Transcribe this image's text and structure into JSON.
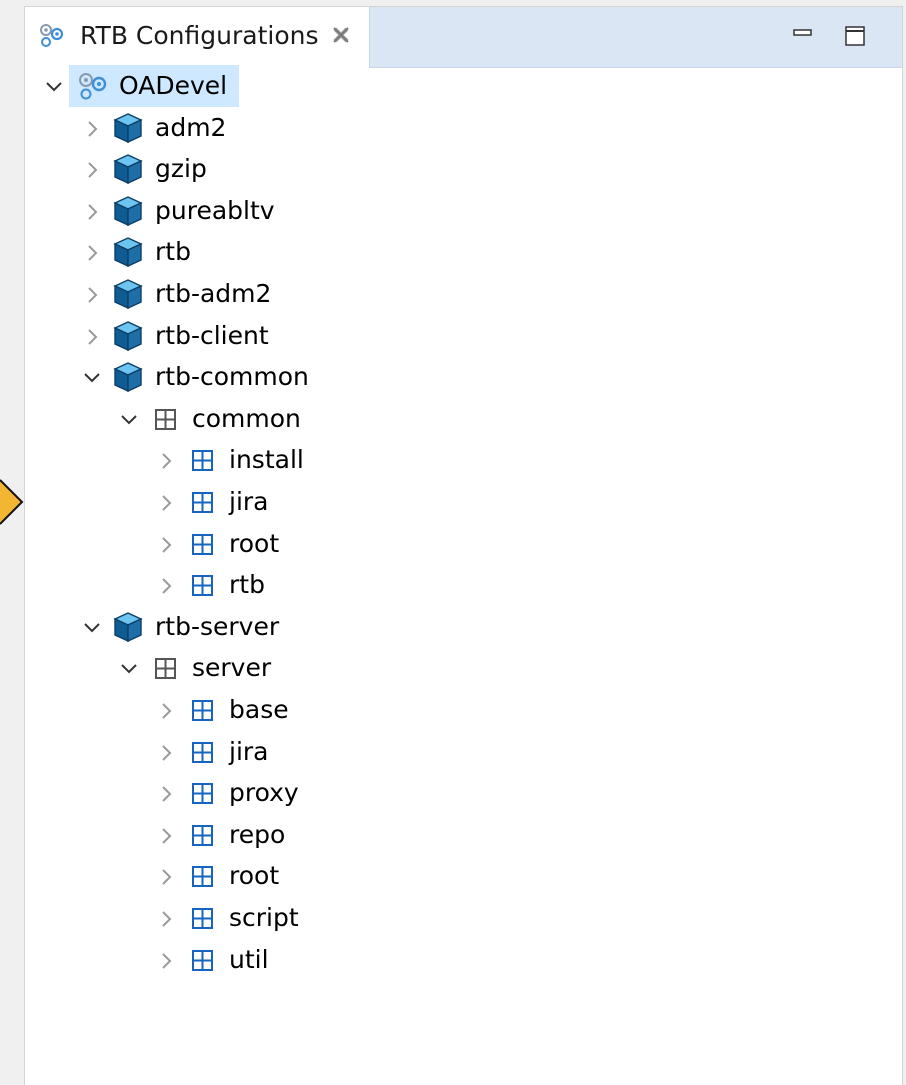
{
  "view": {
    "title": "RTB Configurations",
    "icon": "gear-config-icon",
    "close_icon": "close-icon",
    "controls": {
      "minimize": "minimize-icon",
      "maximize": "maximize-icon"
    }
  },
  "colors": {
    "tab_bar": "#dae6f4",
    "selection": "#cde8ff",
    "cube": "#1e6fa8",
    "pointer": "#f2b632"
  },
  "tree": {
    "root": {
      "label": "OADevel",
      "expanded": true,
      "selected": true
    },
    "items": [
      {
        "label": "adm2",
        "type": "product",
        "expanded": false
      },
      {
        "label": "gzip",
        "type": "product",
        "expanded": false
      },
      {
        "label": "pureabltv",
        "type": "product",
        "expanded": false
      },
      {
        "label": "rtb",
        "type": "product",
        "expanded": false
      },
      {
        "label": "rtb-adm2",
        "type": "product",
        "expanded": false
      },
      {
        "label": "rtb-client",
        "type": "product",
        "expanded": false
      },
      {
        "label": "rtb-common",
        "type": "product",
        "expanded": true
      },
      {
        "label": "common",
        "type": "group",
        "expanded": true
      },
      {
        "label": "install",
        "type": "module",
        "expanded": false
      },
      {
        "label": "jira",
        "type": "module",
        "expanded": false
      },
      {
        "label": "root",
        "type": "module",
        "expanded": false
      },
      {
        "label": "rtb",
        "type": "module",
        "expanded": false
      },
      {
        "label": "rtb-server",
        "type": "product",
        "expanded": true
      },
      {
        "label": "server",
        "type": "group",
        "expanded": true
      },
      {
        "label": "base",
        "type": "module",
        "expanded": false
      },
      {
        "label": "jira",
        "type": "module",
        "expanded": false
      },
      {
        "label": "proxy",
        "type": "module",
        "expanded": false
      },
      {
        "label": "repo",
        "type": "module",
        "expanded": false
      },
      {
        "label": "root",
        "type": "module",
        "expanded": false
      },
      {
        "label": "script",
        "type": "module",
        "expanded": false
      },
      {
        "label": "util",
        "type": "module",
        "expanded": false
      }
    ]
  }
}
